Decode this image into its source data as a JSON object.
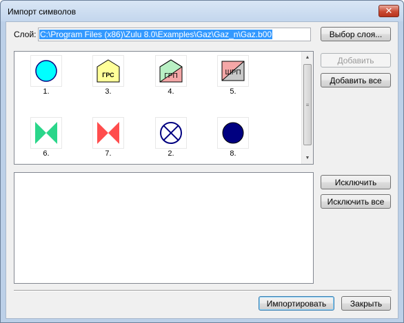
{
  "window": {
    "title": "Импорт символов",
    "close_glyph": "✕"
  },
  "layer": {
    "label": "Слой:",
    "path": "C:\\Program Files (x86)\\Zulu 8.0\\Examples\\Gaz\\Gaz_n\\Gaz.b00",
    "select_button": "Выбор слоя..."
  },
  "symbols": [
    {
      "caption": "1.",
      "icon": "cyan-circle-icon"
    },
    {
      "caption": "3.",
      "icon": "grs-pentagon-icon",
      "text": "ГРС"
    },
    {
      "caption": "4.",
      "icon": "grp-pentagon-icon",
      "text": "ГРП"
    },
    {
      "caption": "5.",
      "icon": "shrp-square-icon",
      "text": "ШРП"
    },
    {
      "caption": "6.",
      "icon": "green-valve-icon"
    },
    {
      "caption": "7.",
      "icon": "red-valve-icon"
    },
    {
      "caption": "2.",
      "icon": "crossed-circle-icon"
    },
    {
      "caption": "8.",
      "icon": "navy-circle-icon"
    }
  ],
  "buttons": {
    "add": "Добавить",
    "add_all": "Добавить все",
    "exclude": "Исключить",
    "exclude_all": "Исключить все",
    "import": "Импортировать",
    "close": "Закрыть"
  },
  "scrollbar": {
    "up_glyph": "▲",
    "down_glyph": "▼",
    "grip_glyph": "≡"
  },
  "colors": {
    "cyan": "#00ffff",
    "yellow": "#ffff99",
    "green": "#2ad68a",
    "red": "#ff4d4d",
    "navy": "#000080",
    "pink": "#f4a7a7",
    "gray": "#c8c8c8"
  }
}
